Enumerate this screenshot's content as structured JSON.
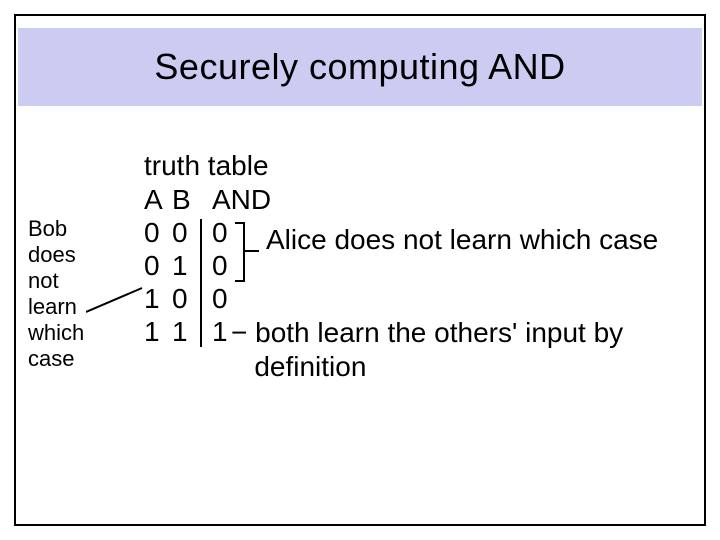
{
  "title": "Securely computing AND",
  "table": {
    "heading": "truth table",
    "cols": {
      "a": "A",
      "b": "B",
      "out": "AND"
    },
    "rows": [
      {
        "a": "0",
        "b": "0",
        "out": "0"
      },
      {
        "a": "0",
        "b": "1",
        "out": "0"
      },
      {
        "a": "1",
        "b": "0",
        "out": "0"
      },
      {
        "a": "1",
        "b": "1",
        "out": "1"
      }
    ]
  },
  "annotations": {
    "bob": "Bob\ndoes\nnot\nlearn\nwhich\ncase",
    "alice": "Alice does not learn which case",
    "both": "− both learn the others' input by\n   definition"
  }
}
